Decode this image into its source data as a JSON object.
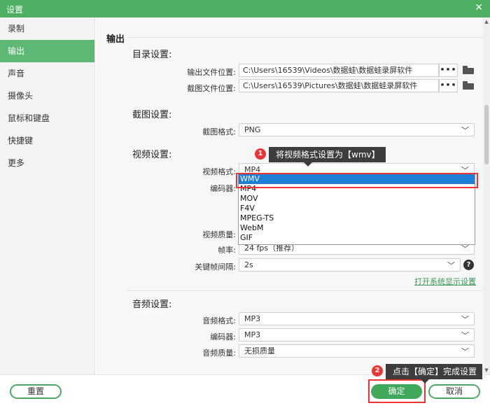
{
  "window": {
    "title": "设置"
  },
  "sidebar": {
    "items": [
      {
        "label": "录制"
      },
      {
        "label": "输出"
      },
      {
        "label": "声音"
      },
      {
        "label": "摄像头"
      },
      {
        "label": "鼠标和键盘"
      },
      {
        "label": "快捷键"
      },
      {
        "label": "更多"
      }
    ],
    "active_index": 1
  },
  "output": {
    "section_title": "输出",
    "dirs": {
      "heading": "目录设置:",
      "output_label": "输出文件位置:",
      "output_path": "C:\\Users\\16539\\Videos\\数据蛙\\数据蛙录屏软件",
      "screenshot_label": "截图文件位置:",
      "screenshot_path": "C:\\Users\\16539\\Pictures\\数据蛙\\数据蛙录屏软件",
      "browse_label": "•••"
    },
    "screenshot": {
      "heading": "截图设置:",
      "format_label": "截图格式:",
      "format_value": "PNG"
    },
    "video": {
      "heading": "视频设置:",
      "format_label": "视频格式:",
      "format_value": "MP4",
      "encoder_label": "编码器:",
      "quality_label": "视频质量:",
      "fps_label": "帧率:",
      "fps_value": "24 fps（推荐）",
      "keyframe_label": "关键帧间隔:",
      "keyframe_value": "2s",
      "help_icon": "?",
      "display_link": "打开系统显示设置",
      "format_options": [
        "WMV",
        "MP4",
        "MOV",
        "F4V",
        "MPEG-TS",
        "WebM",
        "GIF"
      ],
      "highlighted_option": "WMV"
    },
    "audio": {
      "heading": "音频设置:",
      "format_label": "音频格式:",
      "format_value": "MP3",
      "encoder_label": "编码器:",
      "encoder_value": "MP3",
      "quality_label": "音频质量:",
      "quality_value": "无损质量"
    }
  },
  "annotations": {
    "step1": {
      "number": "1",
      "text": "将视频格式设置为【wmv】"
    },
    "step2": {
      "number": "2",
      "text": "点击【确定】完成设置"
    },
    "accent_color": "#e33333"
  },
  "footer": {
    "reset_label": "重置",
    "ok_label": "确定",
    "cancel_label": "取消"
  },
  "colors": {
    "brand_green": "#4caf61",
    "active_nav": "#5cb873",
    "selection_blue": "#1e7fd6",
    "link_green": "#3c9a56"
  }
}
